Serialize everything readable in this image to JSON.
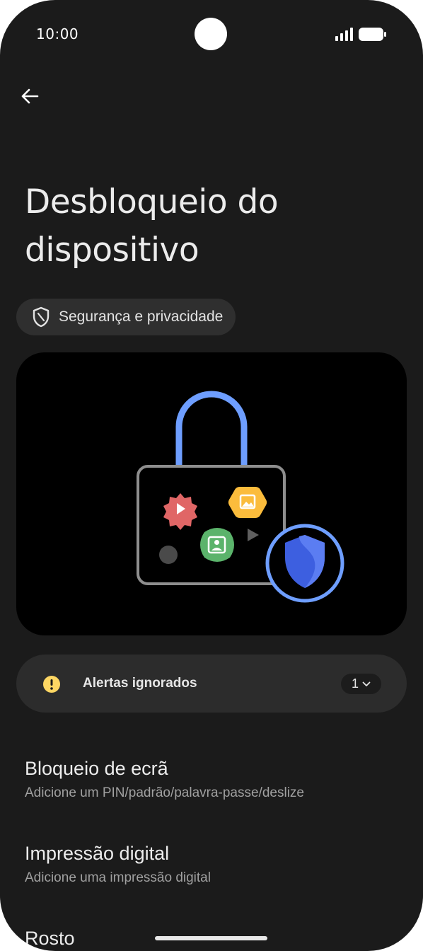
{
  "status_bar": {
    "time": "10:00"
  },
  "header": {
    "back_icon": "arrow-left-icon"
  },
  "page": {
    "title": "Desbloqueio do dispositivo",
    "category_chip": {
      "icon": "shield-icon",
      "label": "Segurança e privacidade"
    }
  },
  "alerts": {
    "icon": "warning-icon",
    "label": "Alertas ignorados",
    "count": "1",
    "accent": "#fdd663"
  },
  "settings": [
    {
      "title": "Bloqueio de ecrã",
      "subtitle": "Adicione um PIN/padrão/palavra-passe/deslize"
    },
    {
      "title": "Impressão digital",
      "subtitle": "Adicione uma impressão digital"
    },
    {
      "title": "Rosto"
    }
  ],
  "colors": {
    "background": "#1b1b1b",
    "chip_bg": "#2f2f2f",
    "card_bg": "#2c2c2c",
    "lock_blue": "#6e9eff",
    "shield_blue": "#3d5fe0"
  }
}
